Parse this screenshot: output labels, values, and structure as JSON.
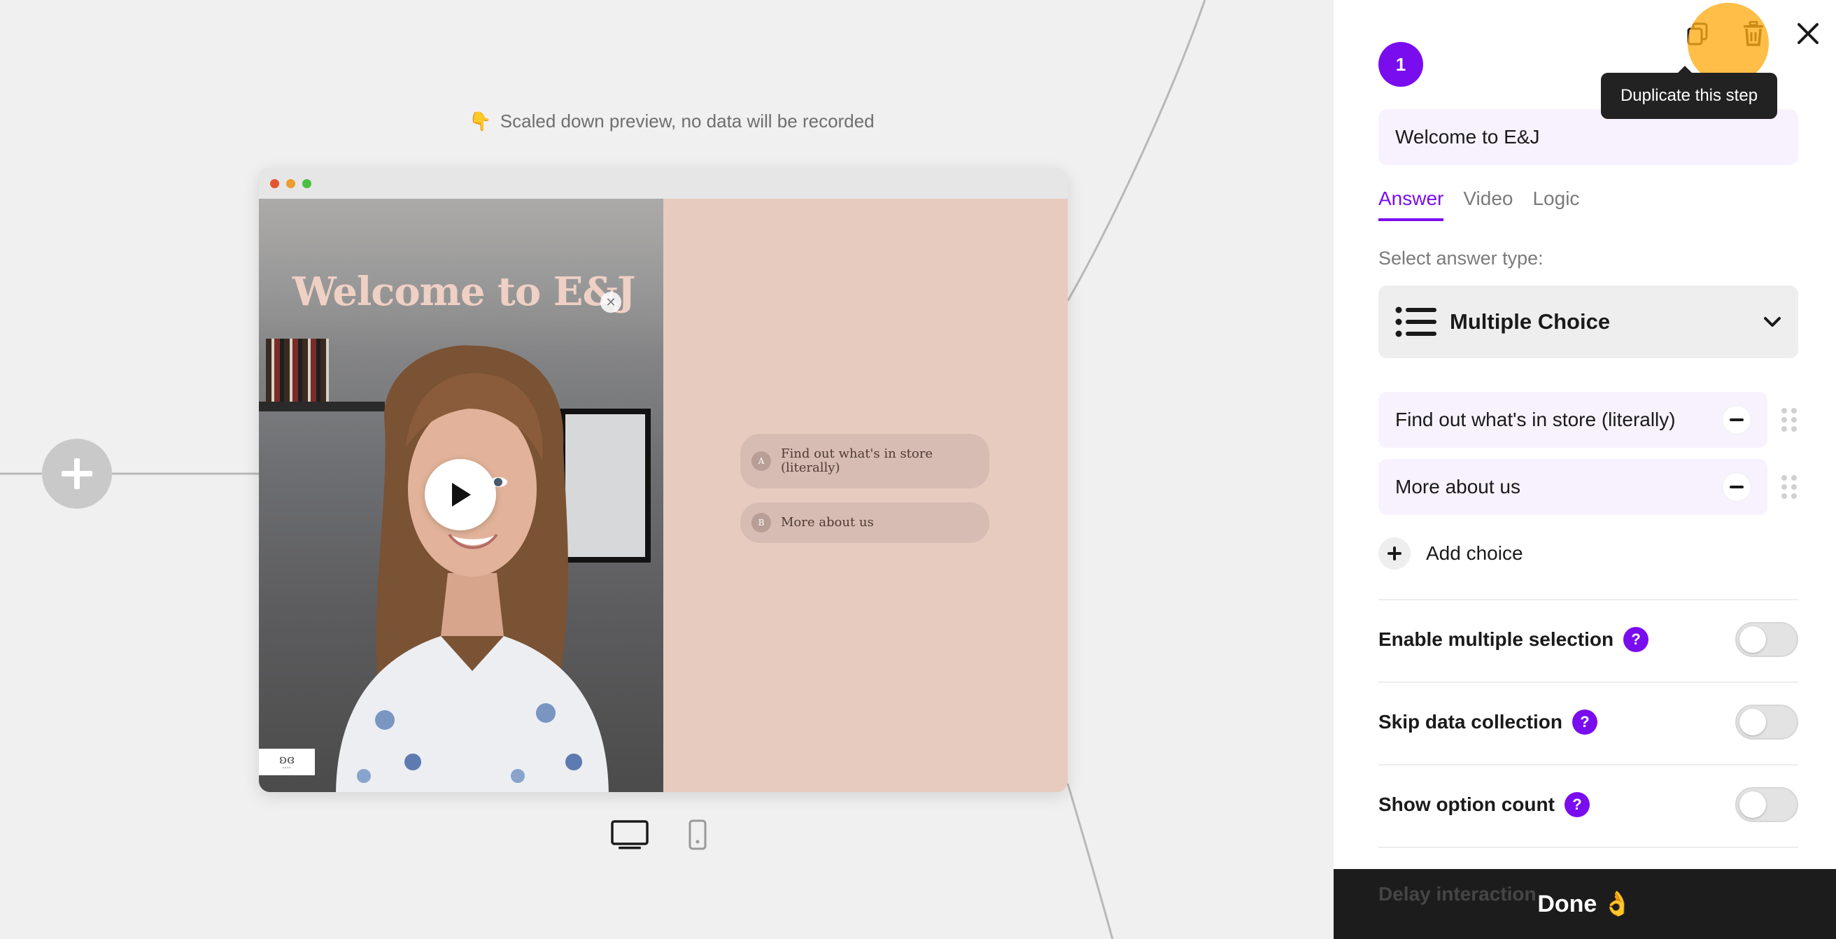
{
  "canvas": {
    "preview_note": "Scaled down preview, no data will be recorded",
    "preview_note_emoji": "👇"
  },
  "preview": {
    "video_title": "Welcome to E&J",
    "choices": [
      {
        "letter": "A",
        "text": "Find out what's in store (literally)"
      },
      {
        "letter": "B",
        "text": "More about us"
      }
    ]
  },
  "panel": {
    "step_number": "1",
    "tooltip": "Duplicate this step",
    "step_title": "Welcome to E&J",
    "tabs": [
      {
        "label": "Answer",
        "active": true
      },
      {
        "label": "Video",
        "active": false
      },
      {
        "label": "Logic",
        "active": false
      }
    ],
    "answer_type_label": "Select answer type:",
    "answer_type": "Multiple Choice",
    "choices": [
      {
        "text": "Find out what's in store (literally)"
      },
      {
        "text": "More about us"
      }
    ],
    "add_choice_label": "Add choice",
    "toggles": [
      {
        "label": "Enable multiple selection",
        "on": false
      },
      {
        "label": "Skip data collection",
        "on": false
      },
      {
        "label": "Show option count",
        "on": false
      }
    ],
    "partial_row_label": "Delay interaction",
    "done_label": "Done",
    "done_emoji": "👌"
  },
  "colors": {
    "accent": "#7a0dee",
    "canvas_bg": "#f0f0f0",
    "preview_bg": "#e7cbbf",
    "cursor_highlight": "#ffac14"
  }
}
